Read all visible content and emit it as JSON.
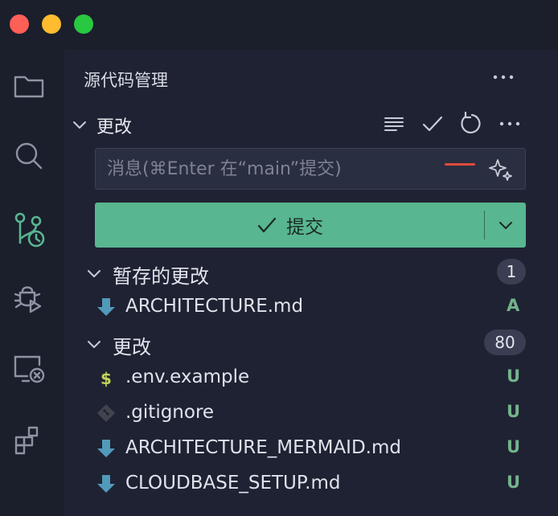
{
  "window": {
    "controls": [
      "close",
      "minimize",
      "maximize"
    ]
  },
  "activity_bar": {
    "icons": [
      "files-icon",
      "search-icon",
      "source-control-icon",
      "run-debug-icon",
      "remote-explorer-icon",
      "extensions-icon"
    ]
  },
  "panel": {
    "title": "源代码管理",
    "more_label": "···"
  },
  "changes_section": {
    "title": "更改"
  },
  "commit_message": {
    "placeholder": "消息(⌘Enter 在“main”提交)",
    "value": ""
  },
  "commit_button": {
    "label": "提交"
  },
  "staged": {
    "title": "暂存的更改",
    "count": "1",
    "files": [
      {
        "name": "ARCHITECTURE.md",
        "status": "A",
        "icon": "markdown-download-icon"
      }
    ]
  },
  "unstaged": {
    "title": "更改",
    "count": "80",
    "files": [
      {
        "name": ".env.example",
        "status": "U",
        "icon": "dollar-icon"
      },
      {
        "name": ".gitignore",
        "status": "U",
        "icon": "git-icon"
      },
      {
        "name": "ARCHITECTURE_MERMAID.md",
        "status": "U",
        "icon": "markdown-download-icon"
      },
      {
        "name": "CLOUDBASE_SETUP.md",
        "status": "U",
        "icon": "markdown-download-icon"
      }
    ]
  },
  "colors": {
    "accent": "#58b690",
    "status_added": "#73b38c",
    "status_untracked": "#73b38c",
    "markdown_icon": "#519aba",
    "dollar_icon": "#c4d35a"
  }
}
